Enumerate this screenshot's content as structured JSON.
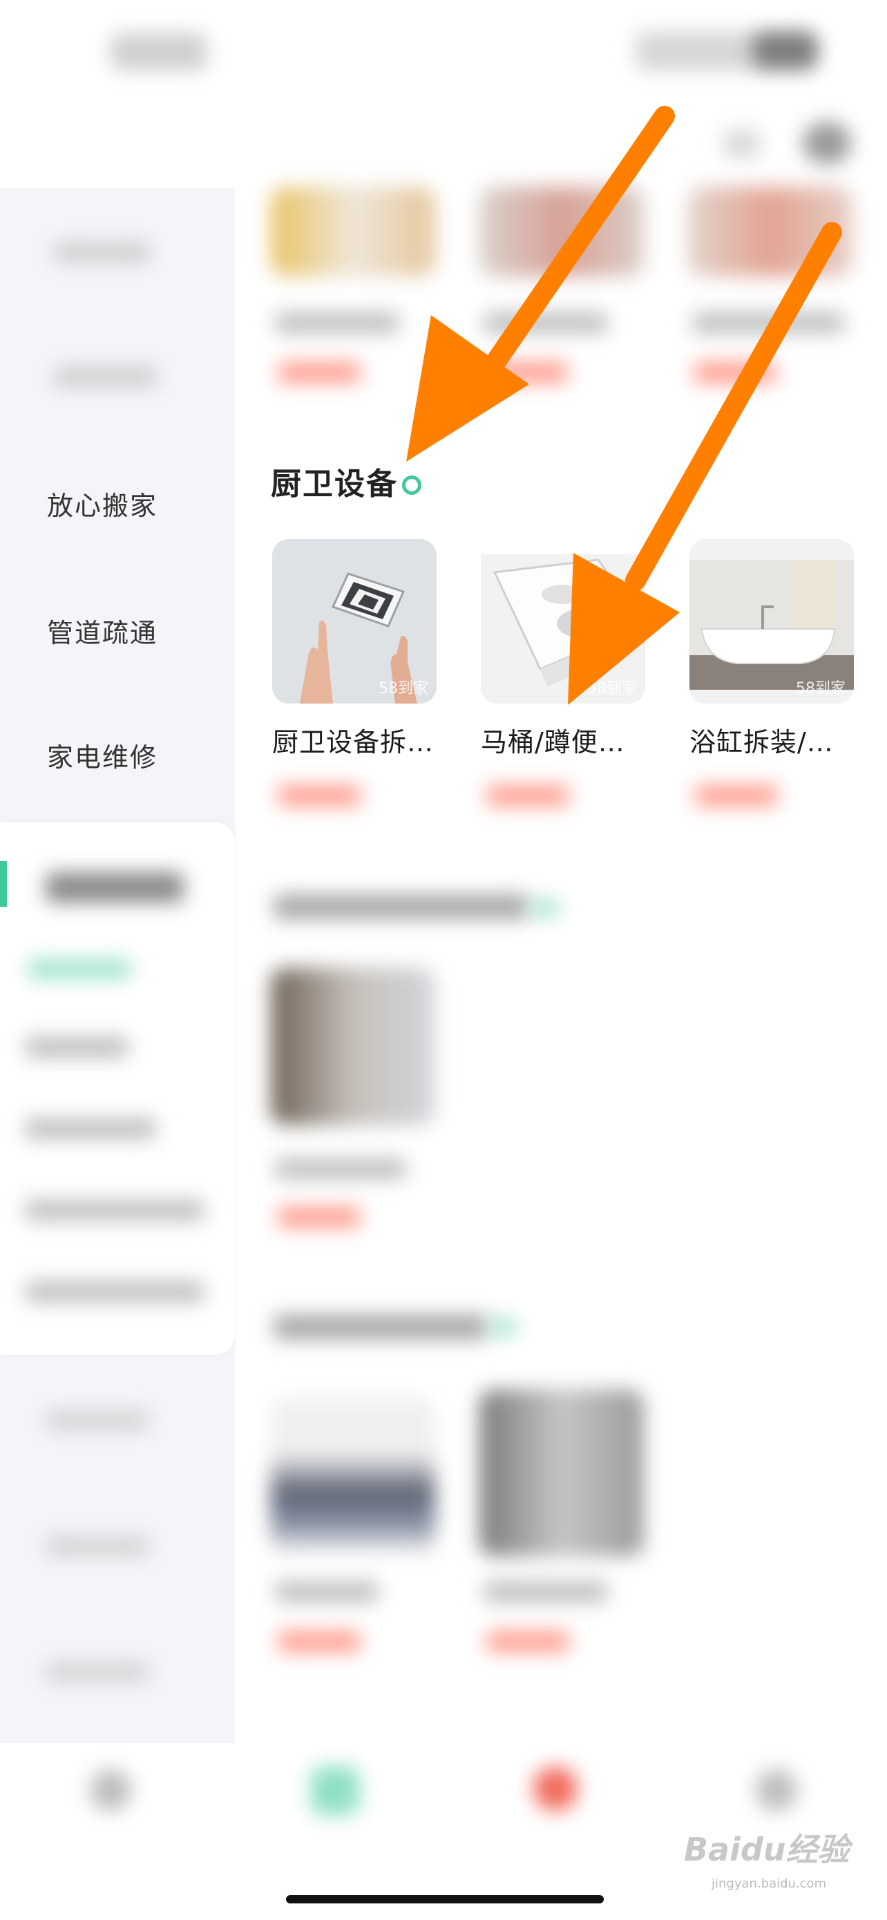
{
  "sidebar": {
    "items": [
      {
        "label": "放心搬家"
      },
      {
        "label": "管道疏通"
      },
      {
        "label": "家电维修"
      }
    ]
  },
  "section": {
    "title": "厨卫设备",
    "products": [
      {
        "name": "厨卫设备拆…",
        "watermark": "58到家"
      },
      {
        "name": "马桶/蹲便…",
        "watermark": "58到家"
      },
      {
        "name": "浴缸拆装/…",
        "watermark": "58到家"
      }
    ]
  },
  "overlay": {
    "arrow_color": "#ff8000",
    "watermark_main": "Baidu经验",
    "watermark_sub": "jingyan.baidu.com"
  },
  "colors": {
    "accent": "#3fc99c",
    "price": "#ff6a55",
    "sidebar_bg": "#f4f5f9"
  }
}
